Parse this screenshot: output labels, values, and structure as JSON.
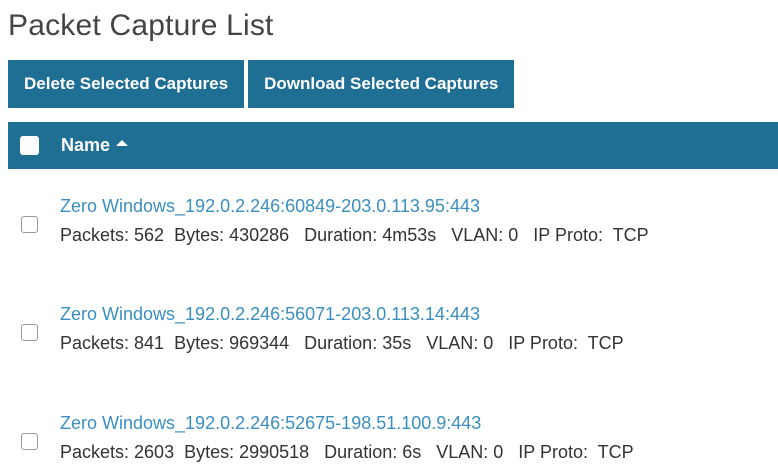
{
  "page_title": "Packet Capture List",
  "toolbar": {
    "delete_label": "Delete Selected Captures",
    "download_label": "Download Selected Captures"
  },
  "table": {
    "column_name": "Name",
    "sort_direction": "ascending",
    "rows": [
      {
        "name": "Zero Windows_192.0.2.246:60849-203.0.113.95:443",
        "meta": "Packets: 562  Bytes: 430286   Duration: 4m53s   VLAN: 0   IP Proto:  TCP"
      },
      {
        "name": "Zero Windows_192.0.2.246:56071-203.0.113.14:443",
        "meta": "Packets: 841  Bytes: 969344   Duration: 35s   VLAN: 0   IP Proto:  TCP"
      },
      {
        "name": "Zero Windows_192.0.2.246:52675-198.51.100.9:443",
        "meta": "Packets: 2603  Bytes: 2990518   Duration: 6s   VLAN: 0   IP Proto:  TCP"
      }
    ]
  },
  "colors": {
    "accent": "#1f6e94",
    "link": "#3a8fbf"
  }
}
